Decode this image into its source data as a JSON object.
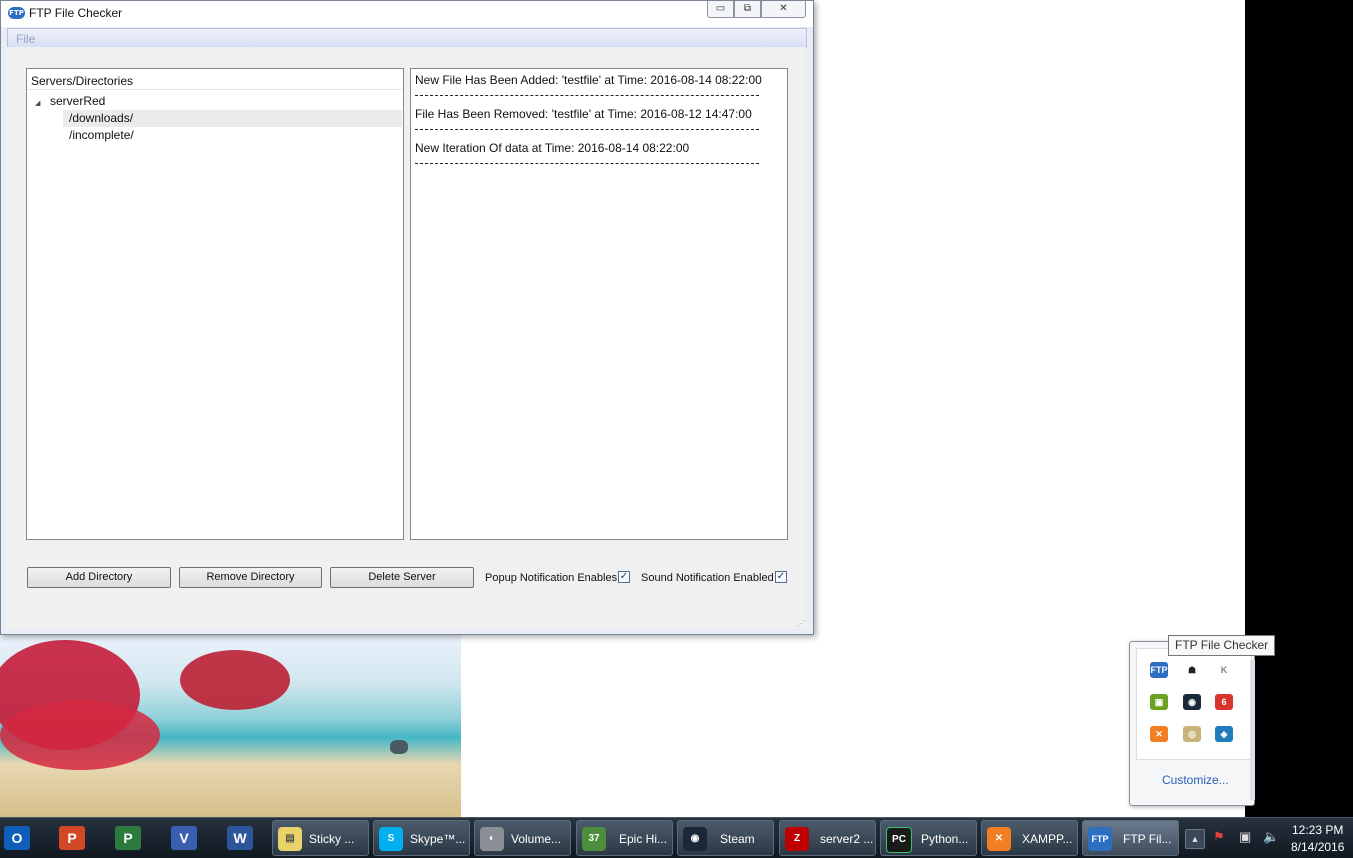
{
  "window": {
    "title": "FTP File Checker",
    "app_icon_text": "FTP",
    "controls": {
      "minimize": "▭",
      "maximize": "⧉",
      "close": "✕"
    },
    "menu": {
      "file": "File"
    }
  },
  "tree": {
    "header": "Servers/Directories",
    "expand_glyph": "◢",
    "server": "serverRed",
    "directories": [
      "/downloads/",
      "/incomplete/"
    ]
  },
  "log": {
    "entries": [
      "New File Has Been Added: 'testfile' at Time: 2016-08-14 08:22:00",
      "File Has Been Removed: 'testfile' at Time: 2016-08-12 14:47:00",
      "New Iteration Of data at Time: 2016-08-14 08:22:00"
    ]
  },
  "buttons": {
    "add_directory": "Add Directory",
    "remove_directory": "Remove Directory",
    "delete_server": "Delete Server"
  },
  "checkboxes": {
    "popup_label": "Popup Notification Enables",
    "popup_checked": true,
    "sound_label": "Sound Notification Enabled",
    "sound_checked": true,
    "check_glyph": "✓"
  },
  "tray_popup": {
    "tooltip": "FTP File Checker",
    "customize": "Customize...",
    "icons": [
      {
        "name": "ftp-tray-icon",
        "text": "FTP",
        "color": "#2c6fc1"
      },
      {
        "name": "ghost-tray-icon",
        "text": "☗",
        "color": "#222222"
      },
      {
        "name": "k-tray-icon",
        "text": "K",
        "color": "#7a8592"
      },
      {
        "name": "nvidia-tray-icon",
        "text": "▣",
        "color": "#6aa321"
      },
      {
        "name": "steam-tray-icon",
        "text": "◉",
        "color": "#1b2838"
      },
      {
        "name": "badge-tray-icon",
        "text": "6",
        "color": "#d8342c"
      },
      {
        "name": "xampp-tray-icon",
        "text": "✕",
        "color": "#f37e22"
      },
      {
        "name": "disc-tray-icon",
        "text": "◎",
        "color": "#c9b37a"
      },
      {
        "name": "network-tray-icon",
        "text": "◈",
        "color": "#1f7dbd"
      }
    ]
  },
  "taskbar": {
    "pinned": [
      {
        "name": "outlook-icon",
        "text": "O",
        "color": "#0f5fb8"
      },
      {
        "name": "powerpoint-icon",
        "text": "P",
        "color": "#d24726"
      },
      {
        "name": "project-icon",
        "text": "P",
        "color": "#2c7b3c"
      },
      {
        "name": "visio-icon",
        "text": "V",
        "color": "#3a5fb0"
      },
      {
        "name": "word-icon",
        "text": "W",
        "color": "#2b579a"
      }
    ],
    "tasks": [
      {
        "name": "task-sticky",
        "label": "Sticky ...",
        "icon": "▤",
        "color": "#e8d36a"
      },
      {
        "name": "task-skype",
        "label": "Skype™...",
        "icon": "S",
        "color": "#00aff0"
      },
      {
        "name": "task-volume",
        "label": "Volume...",
        "icon": "◐",
        "color": "#8a8f96"
      },
      {
        "name": "task-epic",
        "label": "Epic Hi...",
        "icon": "37",
        "color": "#4d8e3a"
      },
      {
        "name": "task-steam",
        "label": "Steam",
        "icon": "◉",
        "color": "#1b2838"
      },
      {
        "name": "task-filezilla",
        "label": "server2 ...",
        "icon": "Z",
        "color": "#bf0000"
      },
      {
        "name": "task-pycharm",
        "label": "Python...",
        "icon": "PC",
        "color": "#1a1a1a"
      },
      {
        "name": "task-xampp",
        "label": "XAMPP...",
        "icon": "✕",
        "color": "#f37e22"
      },
      {
        "name": "task-ftp",
        "label": "FTP Fil...",
        "icon": "FTP",
        "color": "#2c6fc1"
      }
    ],
    "tray": {
      "up_arrow": "▲",
      "flag": "⚑",
      "network": "▣",
      "volume": "🔈"
    },
    "clock": {
      "time": "12:23 PM",
      "date": "8/14/2016"
    }
  }
}
